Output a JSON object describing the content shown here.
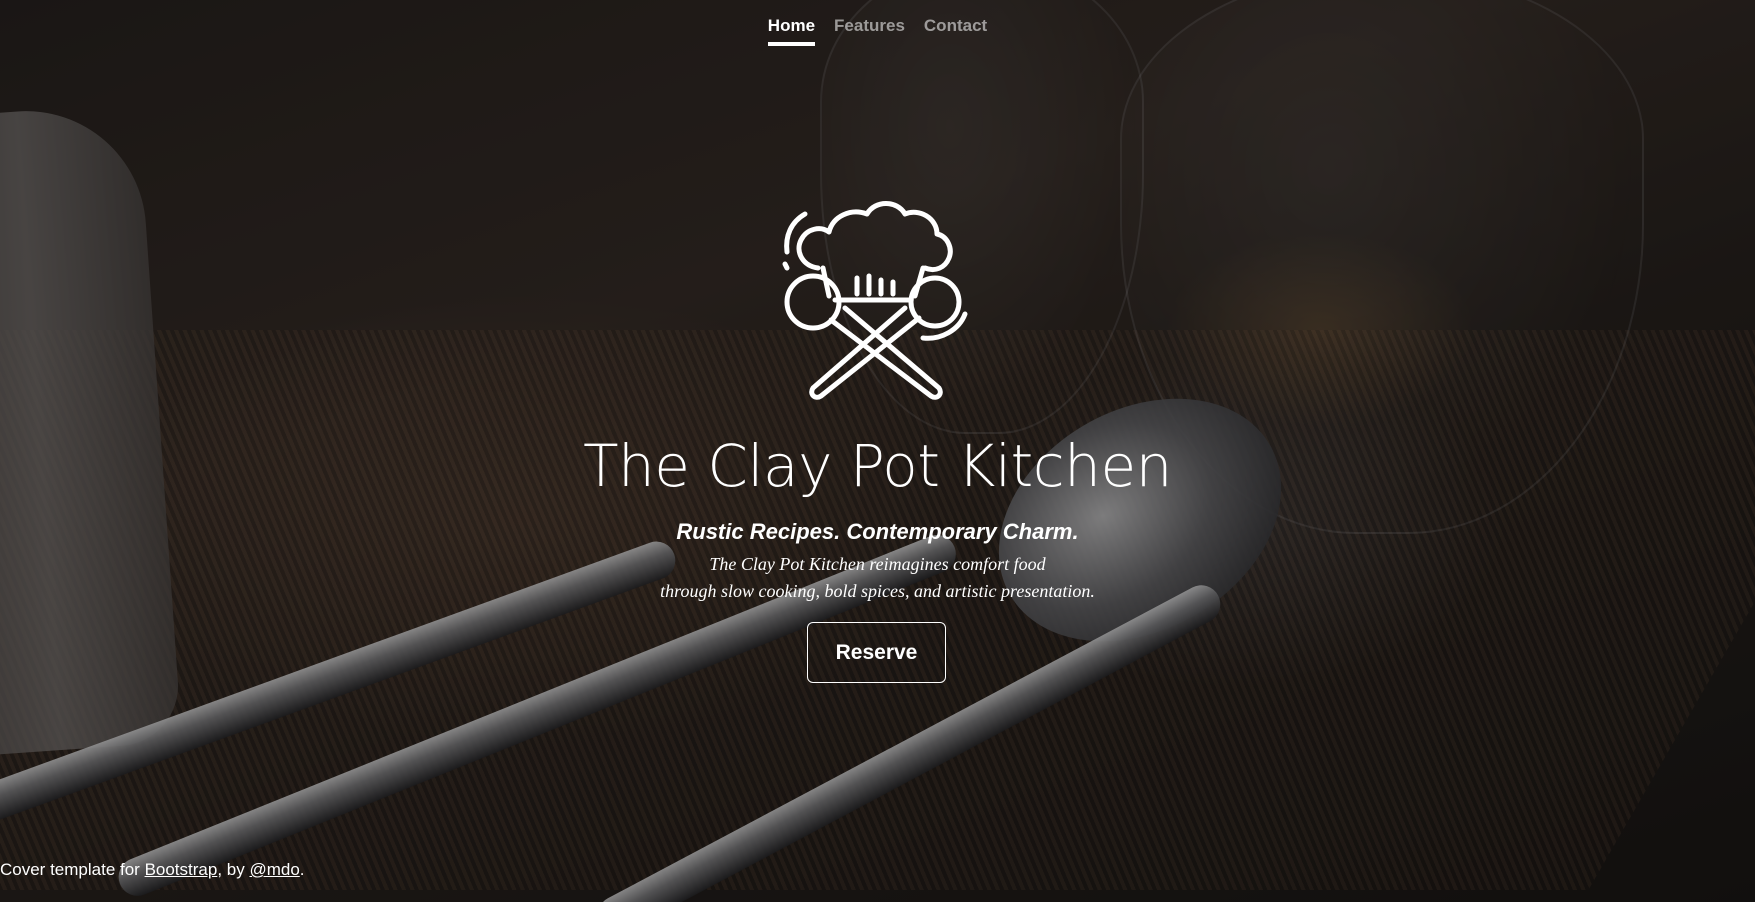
{
  "nav": {
    "items": [
      {
        "label": "Home",
        "active": true
      },
      {
        "label": "Features",
        "active": false
      },
      {
        "label": "Contact",
        "active": false
      }
    ]
  },
  "logo": {
    "icon": "chef-hat-crossed-spoons-icon"
  },
  "hero": {
    "title": "The Clay Pot Kitchen",
    "tagline": "Rustic Recipes. Contemporary Charm.",
    "description_line1": "The Clay Pot Kitchen reimagines comfort food",
    "description_line2": "through slow cooking, bold spices, and artistic presentation.",
    "cta_label": "Reserve"
  },
  "footer": {
    "prefix": "Cover template for ",
    "bootstrap_link": "Bootstrap",
    "middle": ", by ",
    "author_link": "@mdo",
    "suffix": "."
  },
  "colors": {
    "text": "#ffffff",
    "nav_inactive": "rgba(255,255,255,0.55)",
    "overlay": "rgba(0,0,0,0.38)"
  }
}
